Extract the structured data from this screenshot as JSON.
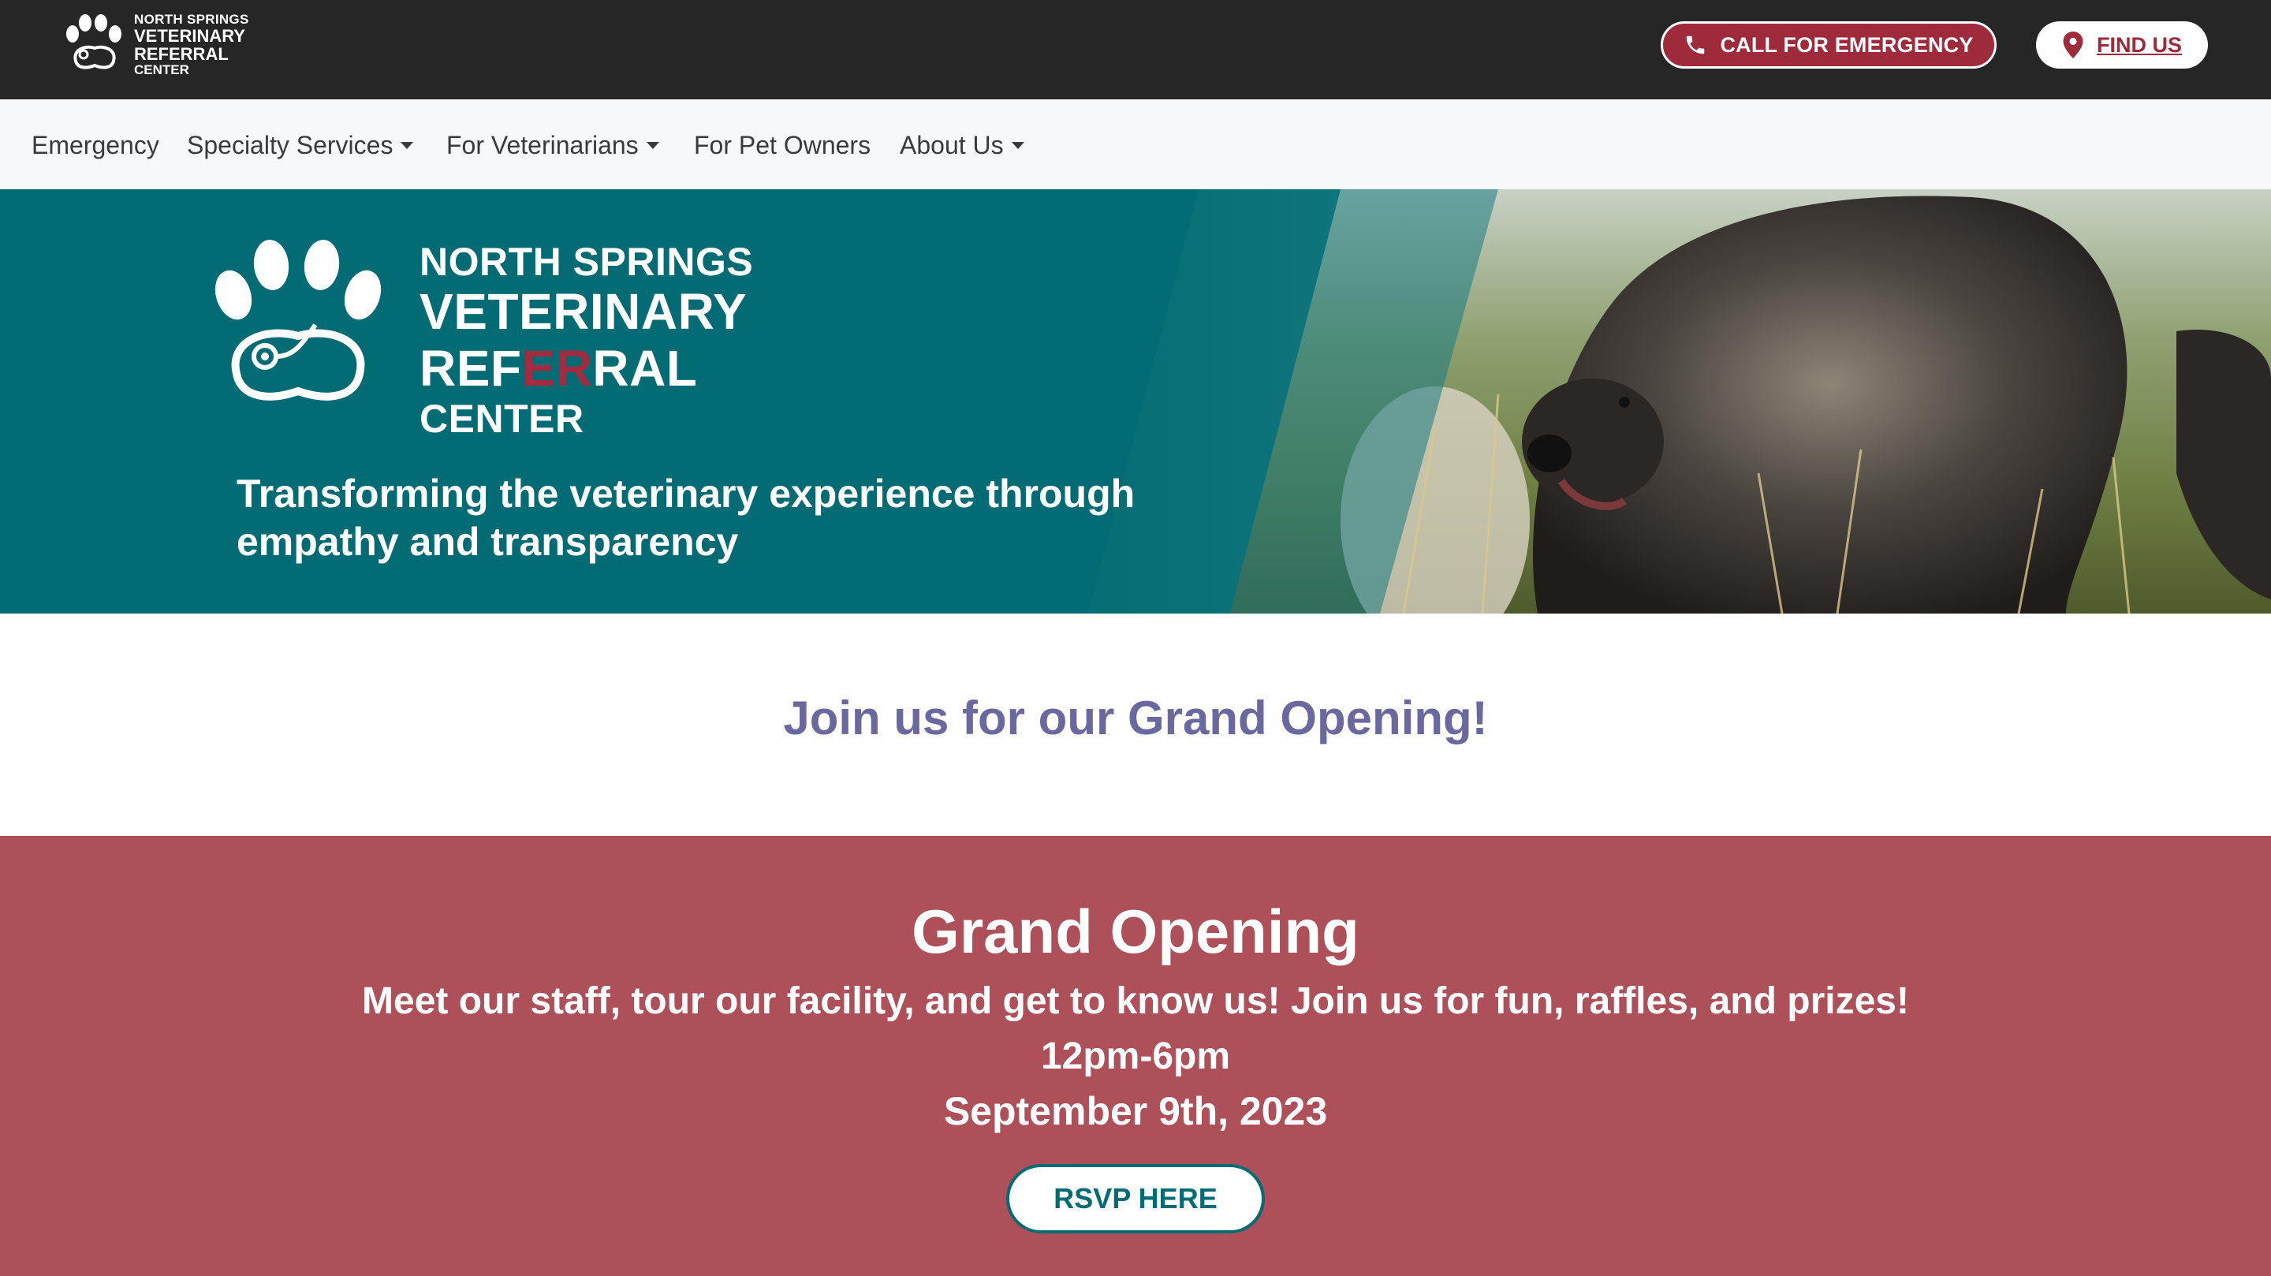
{
  "brand": {
    "line1": "NORTH SPRINGS",
    "line2": "VETERINARY",
    "line3": "REFERRAL",
    "line4": "CENTER",
    "accent_color": "#a32a3f",
    "teal_color": "#036b73"
  },
  "topbar": {
    "emergency_label": "CALL FOR EMERGENCY",
    "emergency_icon": "phone-icon",
    "find_label": "FIND US",
    "find_icon": "map-pin-icon"
  },
  "nav": {
    "items": [
      {
        "label": "Emergency",
        "dropdown": false
      },
      {
        "label": "Specialty Services",
        "dropdown": true
      },
      {
        "label": "For Veterinarians",
        "dropdown": true
      },
      {
        "label": "For Pet Owners",
        "dropdown": false
      },
      {
        "label": "About Us",
        "dropdown": true
      }
    ]
  },
  "hero": {
    "logo_line1": "NORTH SPRINGS",
    "logo_line2": "VETERINARY",
    "logo_line3_a": "REF",
    "logo_line3_b": "ER",
    "logo_line3_c": "RAL",
    "logo_line4": "CENTER",
    "tagline_line1": "Transforming the veterinary experience through",
    "tagline_line2": "empathy and transparency"
  },
  "join": {
    "heading": "Join us for our Grand Opening!"
  },
  "grand_opening": {
    "title": "Grand Opening",
    "description": "Meet our staff, tour our facility, and get to know us! Join us for fun, raffles, and prizes!",
    "time": "12pm-6pm",
    "date": "September 9th, 2023",
    "rsvp_label": "RSVP HERE",
    "background_color": "#ad505a"
  }
}
